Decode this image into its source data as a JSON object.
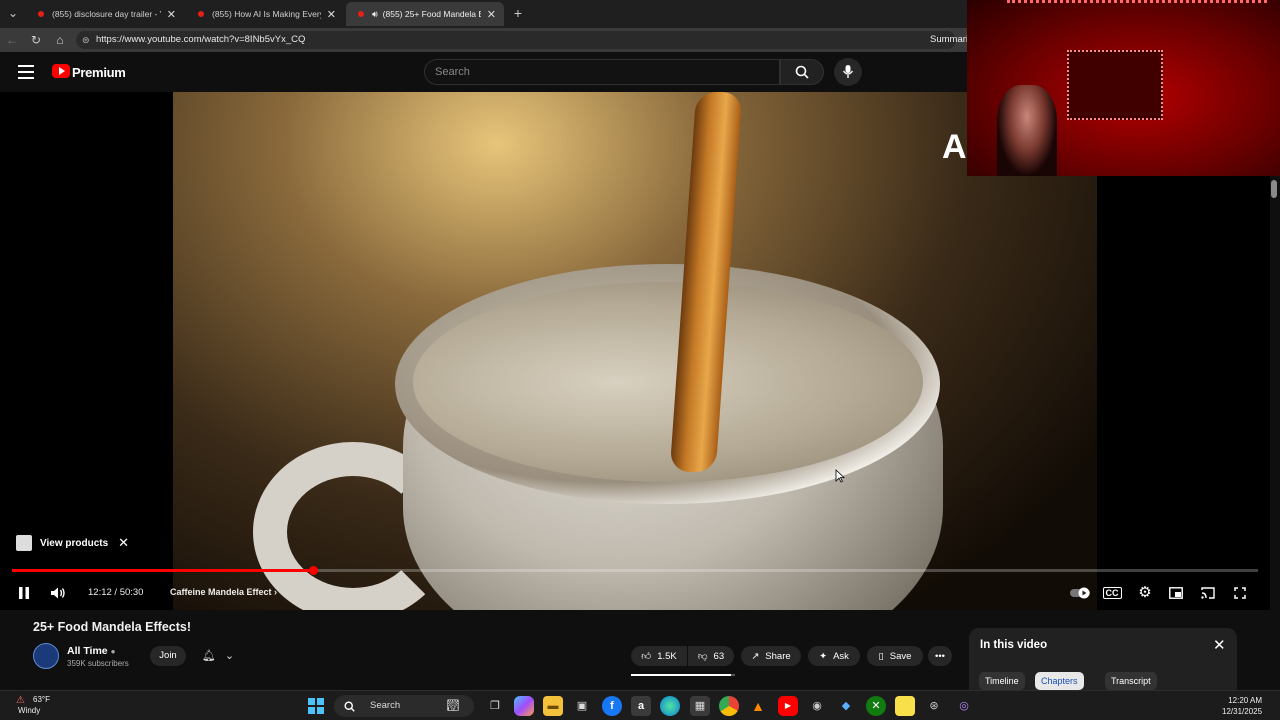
{
  "browser": {
    "tabs": [
      {
        "label": "(855) disclosure day trailer - YouTube"
      },
      {
        "label": "(855) How AI Is Making Everything Worse"
      },
      {
        "label": "(855) 25+ Food Mandela Effects"
      }
    ],
    "url": "https://www.youtube.com/watch?v=8INb5vYx_CQ",
    "summarize_label": "Summari"
  },
  "youtube": {
    "brand_label": "Premium",
    "search_placeholder": "Search"
  },
  "video": {
    "channel_tag": "Al",
    "view_products_label": "View products",
    "current_time": "12:12",
    "duration": "50:30",
    "time_display": "12:12 / 50:30",
    "progress_fraction": 0.2416,
    "chapter_label": "Caffeine Mandela Effect"
  },
  "details": {
    "title": "25+ Food Mandela Effects!",
    "channel_name": "All Time",
    "subscribers": "359K subscribers",
    "join_label": "Join",
    "likes": "1.5K",
    "dislikes": "63",
    "share_label": "Share",
    "ask_label": "Ask",
    "save_label": "Save"
  },
  "panel": {
    "title": "In this video",
    "tabs": [
      "Timeline",
      "Chapters",
      "Transcript"
    ],
    "selected_tab": "Chapters"
  },
  "taskbar": {
    "temperature": "63°F",
    "condition": "Windy",
    "search_label": "Search",
    "time": "12:20 AM",
    "date": "12/31/2025"
  },
  "colors": {
    "accent": "#ff0000",
    "background": "#0f0f0f"
  }
}
